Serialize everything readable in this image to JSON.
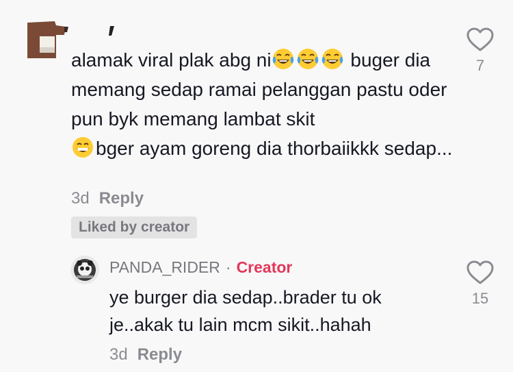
{
  "comment": {
    "text_part1": "alamak viral plak abg ni",
    "text_part2": " buger dia memang sedap ramai pelanggan pastu oder pun byk memang lambat skit",
    "text_part3": "bger ayam goreng dia thorbaiikkk sedap...",
    "emoji_laugh_name": "face-with-tears-of-joy-icon",
    "emoji_grin_name": "grinning-face-icon",
    "time": "3d",
    "reply_label": "Reply",
    "liked_badge": "Liked by creator",
    "like_count": "7"
  },
  "reply": {
    "username": "PANDA_RIDER",
    "separator": "·",
    "creator_label": "Creator",
    "text": "ye burger dia sedap..brader tu ok je..akak tu lain mcm sikit..hahah",
    "time": "3d",
    "reply_label": "Reply",
    "like_count": "15"
  },
  "colors": {
    "creator_accent": "#e3375a",
    "meta_gray": "#8a8b91",
    "background": "#f8f8f8"
  }
}
